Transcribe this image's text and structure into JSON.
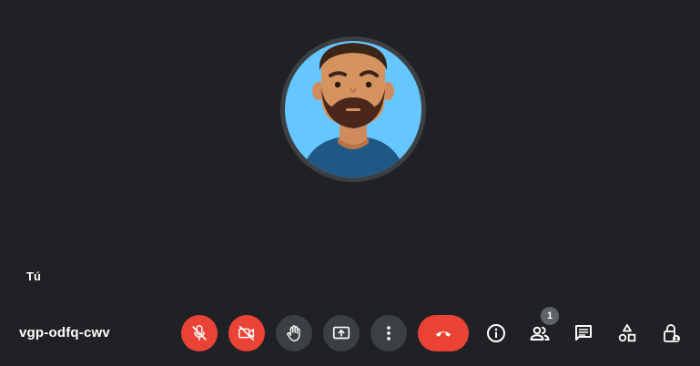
{
  "participant": {
    "label": "Tú"
  },
  "meeting": {
    "code": "vgp-odfq-cwv"
  },
  "controls": [
    {
      "icon": "mic-off-icon",
      "state": "muted",
      "color": "#ea4335"
    },
    {
      "icon": "camera-off-icon",
      "state": "off",
      "color": "#ea4335"
    },
    {
      "icon": "raise-hand-icon",
      "color": "#3c4043"
    },
    {
      "icon": "present-screen-icon",
      "color": "#3c4043"
    },
    {
      "icon": "more-options-icon",
      "color": "#3c4043"
    },
    {
      "icon": "end-call-icon",
      "color": "#ea4335"
    }
  ],
  "side_controls": [
    {
      "icon": "info-icon"
    },
    {
      "icon": "people-icon",
      "badge": "1"
    },
    {
      "icon": "chat-icon"
    },
    {
      "icon": "activities-icon"
    },
    {
      "icon": "host-controls-lock-icon"
    }
  ],
  "colors": {
    "background": "#202124",
    "danger": "#ea4335",
    "button": "#3c4043",
    "avatar_bg": "#66c7ff"
  }
}
